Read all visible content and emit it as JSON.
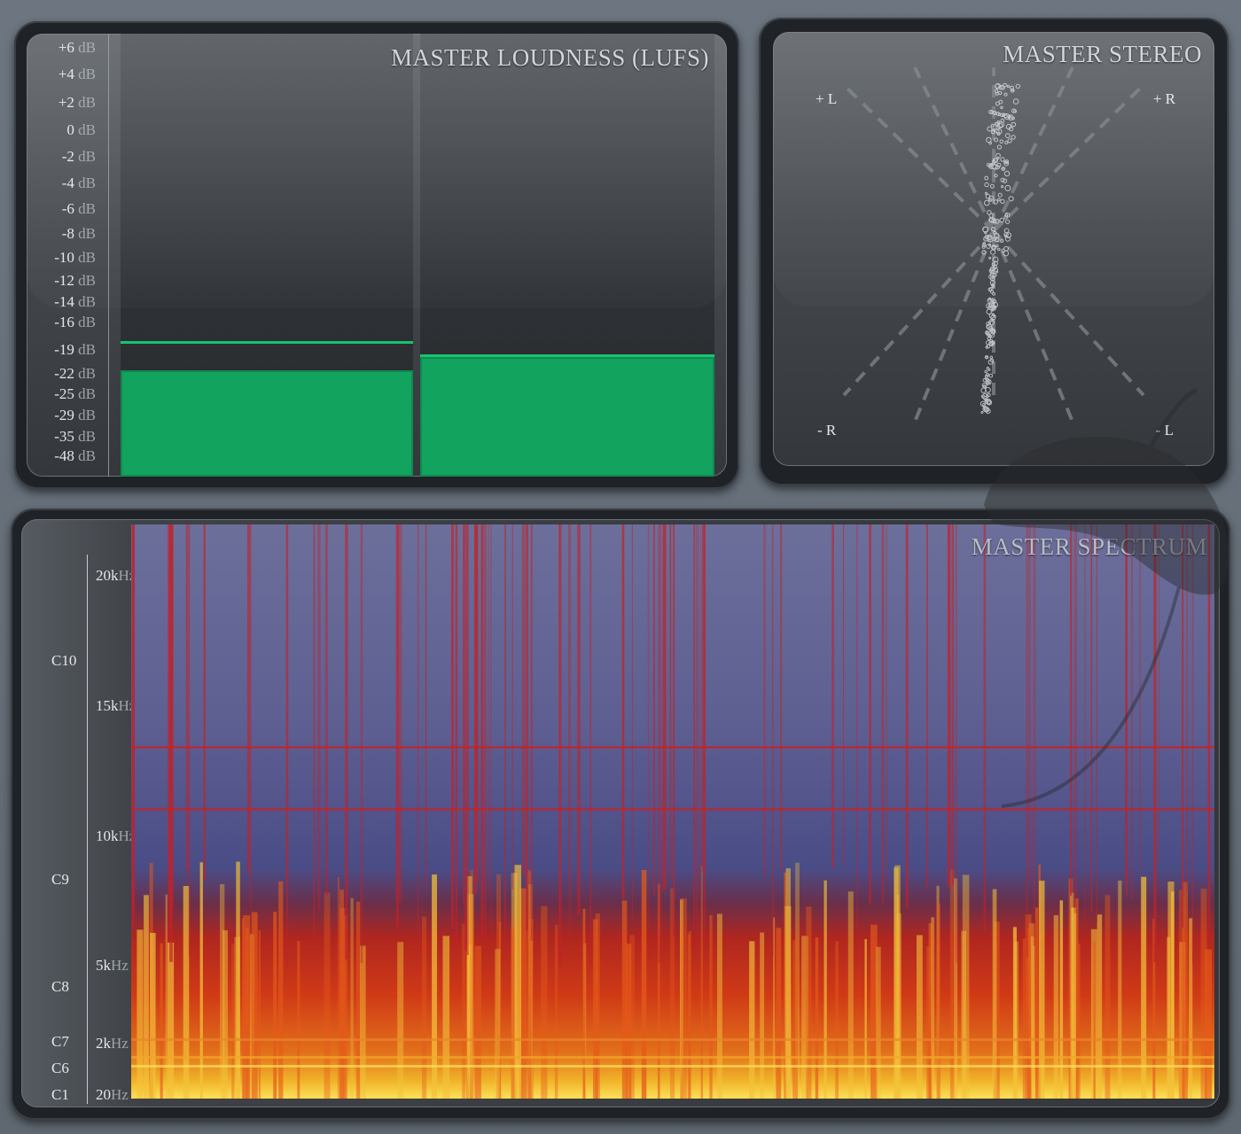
{
  "loudness": {
    "title": "MASTER LOUDNESS (LUFS)",
    "unit": "dB",
    "scale": [
      "+6",
      "+4",
      "+2",
      "0",
      "-2",
      "-4",
      "-6",
      "-8",
      "-10",
      "-12",
      "-14",
      "-16",
      "-19",
      "-22",
      "-25",
      "-29",
      "-35",
      "-48"
    ],
    "channels": [
      {
        "name": "left-channel",
        "level_fraction": 0.24,
        "peak_fraction": 0.3
      },
      {
        "name": "right-channel",
        "level_fraction": 0.27,
        "peak_fraction": 0.27
      }
    ],
    "meter_color": "#12a35f"
  },
  "stereo": {
    "title": "MASTER STEREO",
    "labels": {
      "top_left": "+ L",
      "top_right": "+ R",
      "bottom_left": "- R",
      "bottom_right": "- L"
    }
  },
  "spectrum": {
    "title": "MASTER SPECTRUM",
    "unit": "Hz",
    "freq_labels": [
      "20k",
      "15k",
      "10k",
      "5k",
      "2k",
      "20"
    ],
    "note_labels": [
      "C10",
      "C9",
      "C8",
      "C7",
      "C6",
      "C1"
    ],
    "colors": {
      "low": "#4a4c86",
      "mid": "#cf3a16",
      "high": "#fde058"
    }
  },
  "logo": {
    "name": "fl-studio-fruit-logo"
  }
}
